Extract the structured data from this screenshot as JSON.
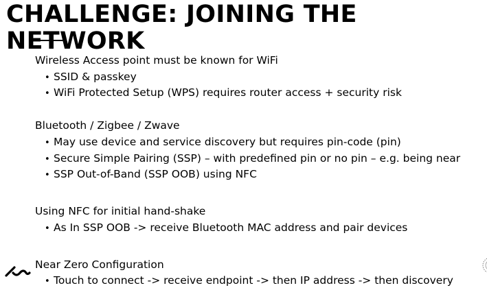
{
  "slide": {
    "title_line1": "CHALLENGE: JOINING THE",
    "title_line2": "NETWORK",
    "sections": [
      {
        "heading": "Wireless Access point must be known for WiFi",
        "bullets": [
          "SSID & passkey",
          "WiFi Protected Setup (WPS) requires router access + security risk"
        ]
      },
      {
        "heading": "Bluetooth / Zigbee / Zwave",
        "bullets": [
          "May use device and service discovery but requires pin-code (pin)",
          "Secure Simple Pairing (SSP) – with predefined pin or no pin – e.g. being near",
          "SSP Out-of-Band (SSP OOB) using NFC"
        ]
      },
      {
        "heading": "Using NFC for initial hand-shake",
        "bullets": [
          "As In SSP OOB -> receive Bluetooth MAC address and pair devices"
        ]
      },
      {
        "heading": "Near Zero Configuration",
        "bullets": [
          "Touch to connect -> receive endpoint -> then IP address -> then discovery"
        ]
      }
    ],
    "bullet_glyph": "•",
    "logo_icon": "brand-logo-icon",
    "corner_icon": "seal-mark-icon"
  }
}
